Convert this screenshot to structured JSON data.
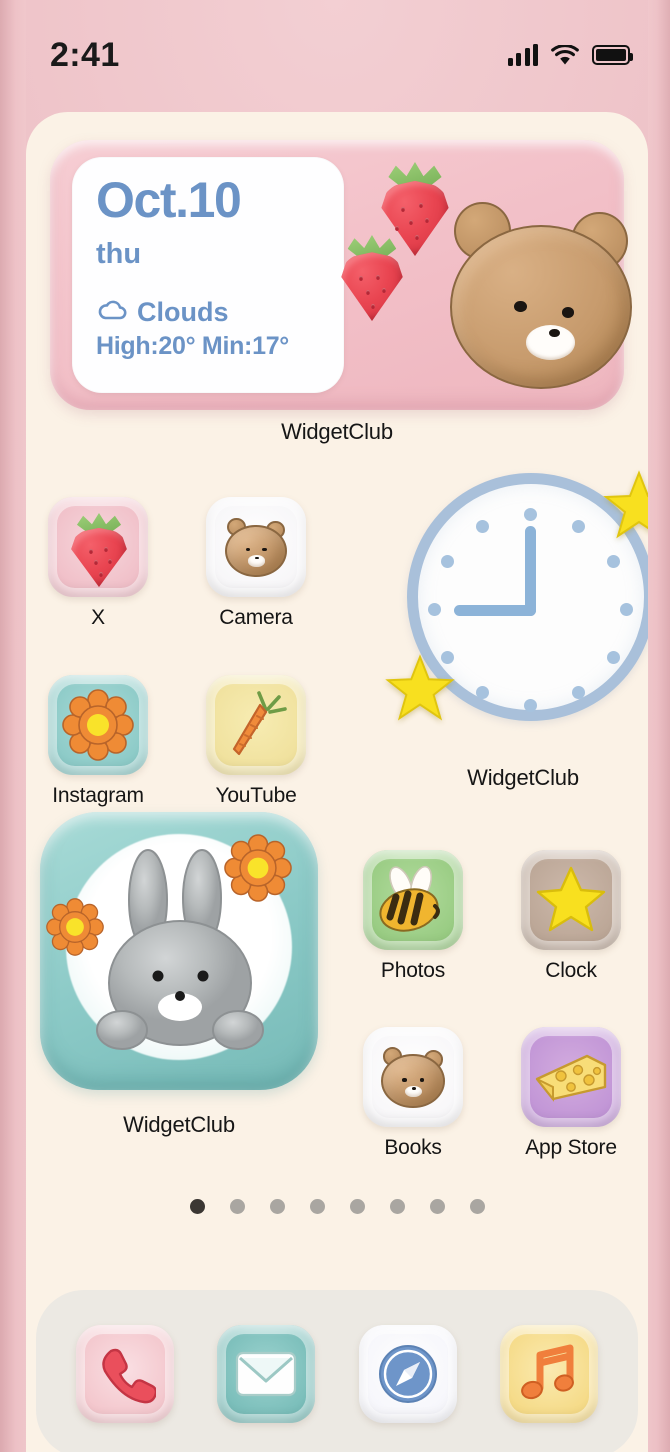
{
  "status_bar": {
    "time": "2:41",
    "signal_icon": "cellular-bars-icon",
    "wifi_icon": "wifi-icon",
    "battery_icon": "battery-full-icon"
  },
  "weather_widget": {
    "label": "WidgetClub",
    "date": "Oct.10",
    "weekday": "thu",
    "condition": "Clouds",
    "condition_icon": "cloud-icon",
    "temps": "High:20° Min:17°",
    "decor": [
      "strawberry",
      "strawberry",
      "bear-face"
    ],
    "colors": {
      "card_bg": "#fefeff",
      "text": "#6b93c6",
      "widget_bg": "#f2bfc7"
    }
  },
  "apps_left": [
    {
      "label": "X",
      "icon": "strawberry-icon",
      "tile_color": "#f3c6cd"
    },
    {
      "label": "Camera",
      "icon": "bear-face-icon",
      "tile_color": "#fdfdfd"
    },
    {
      "label": "Instagram",
      "icon": "flower-icon",
      "tile_color": "#8fcdca"
    },
    {
      "label": "YouTube",
      "icon": "carrot-icon",
      "tile_color": "#f2e3a2"
    }
  ],
  "clock_widget": {
    "label": "WidgetClub",
    "type": "analog-clock",
    "hour_hand": 9,
    "minute_hand": 0,
    "tick_count": 12,
    "decor": [
      "star",
      "star"
    ],
    "colors": {
      "face": "#fdfdfd",
      "rim": "#a9c0da",
      "hands": "#8cb3d8",
      "ticks": "#a6c2de",
      "star": "#f7e03c"
    }
  },
  "bunny_widget": {
    "label": "WidgetClub",
    "icon": "bunny-icon",
    "decor": [
      "flower",
      "flower"
    ],
    "colors": {
      "bg": "#8ccac7",
      "bunny": "#b9bcbd",
      "flower": "#ef8b35"
    }
  },
  "apps_right": [
    {
      "label": "Photos",
      "icon": "bee-icon",
      "tile_color": "#9ccd86"
    },
    {
      "label": "Clock",
      "icon": "star-icon",
      "tile_color": "#bfa99b"
    },
    {
      "label": "Books",
      "icon": "bear-face-icon",
      "tile_color": "#fdfdfd"
    },
    {
      "label": "App Store",
      "icon": "cheese-icon",
      "tile_color": "#c49ad8"
    }
  ],
  "page_indicator": {
    "total": 8,
    "active_index": 0
  },
  "dock": [
    {
      "label": "Phone",
      "icon": "phone-handset-icon",
      "tile_color": "#f4c5cb"
    },
    {
      "label": "Mail",
      "icon": "envelope-icon",
      "tile_color": "#76bcb8"
    },
    {
      "label": "Safari",
      "icon": "compass-icon",
      "tile_color": "#fafafe"
    },
    {
      "label": "Music",
      "icon": "music-note-icon",
      "tile_color": "#f6dc8c"
    }
  ]
}
